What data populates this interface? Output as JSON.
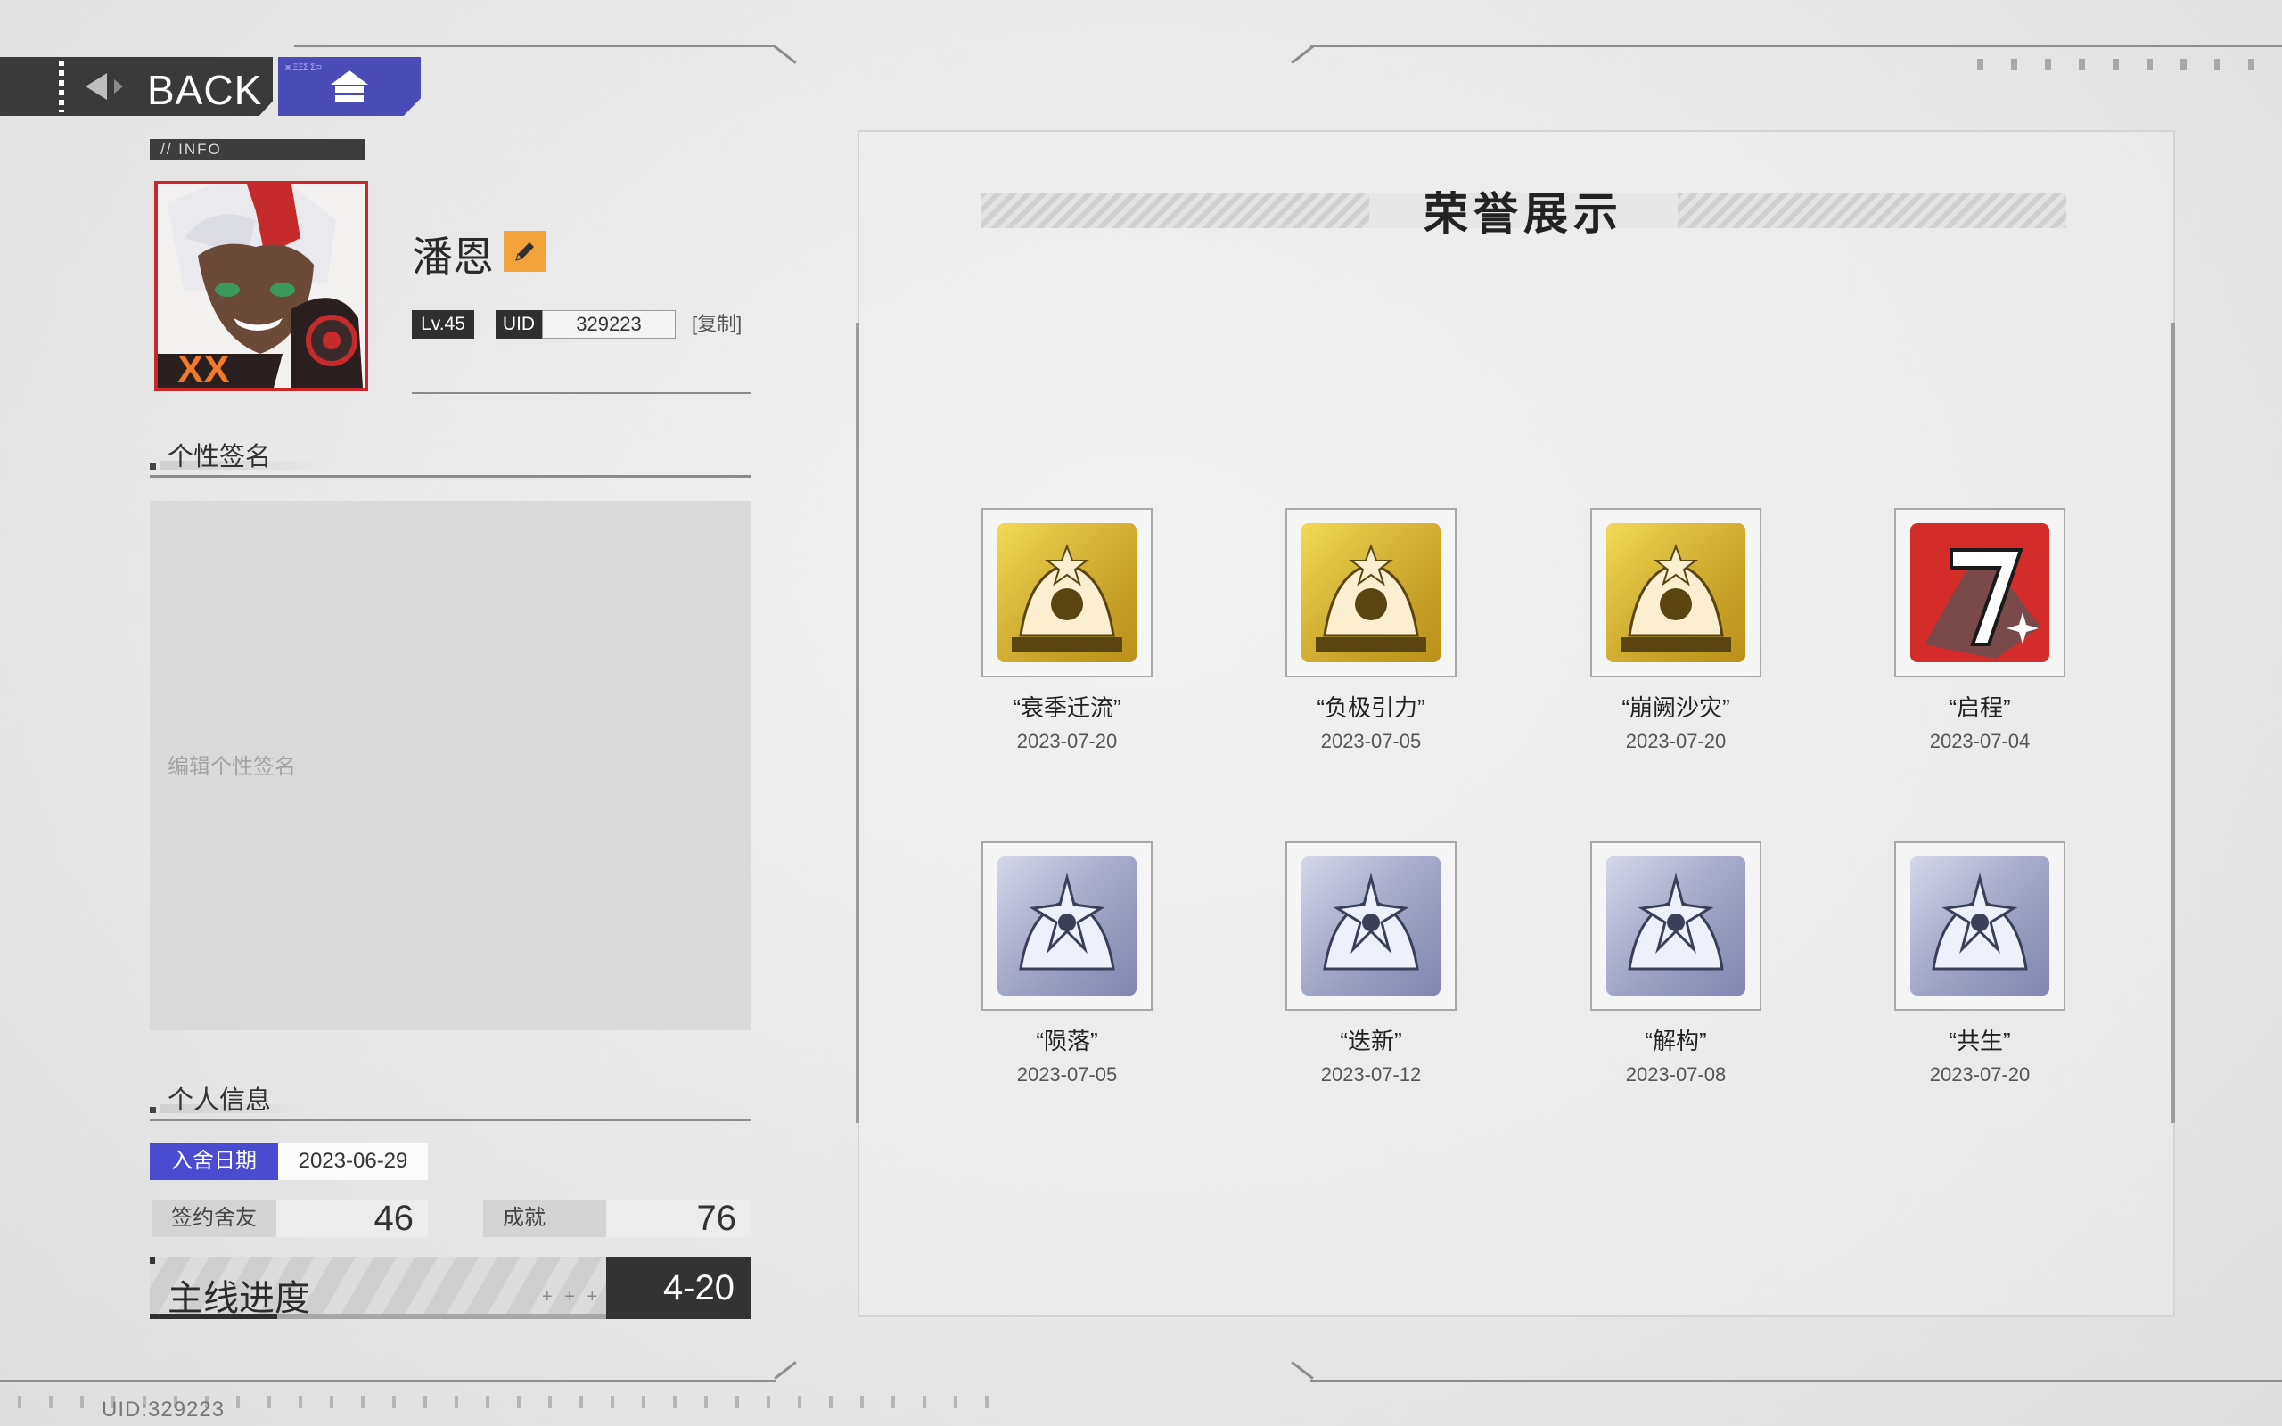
{
  "nav": {
    "back_label": "BACK",
    "home_small_text": "ж ΞΞΣ Σ⊃"
  },
  "info": {
    "tag": "// INFO",
    "name": "潘恩",
    "level": "Lv.45",
    "uid_label": "UID",
    "uid_value": "329223",
    "copy_label": "[复制]"
  },
  "signature": {
    "section_title": "个性签名",
    "placeholder": "编辑个性签名"
  },
  "personal": {
    "section_title": "个人信息",
    "join_label": "入舍日期",
    "join_date": "2023-06-29",
    "friends_label": "签约舍友",
    "friends_value": "46",
    "achievements_label": "成就",
    "achievements_value": "76",
    "progress_label": "主线进度",
    "progress_plus": "+ + +",
    "progress_value": "4-20",
    "progress_fraction": 0.28
  },
  "footer": {
    "uid_text": "UID:329223"
  },
  "honor": {
    "title": "荣誉展示",
    "medals": [
      {
        "name": "“衰季迁流”",
        "date": "2023-07-20",
        "tier": "gold",
        "icon": "gold-mech-medal-icon"
      },
      {
        "name": "“负极引力”",
        "date": "2023-07-05",
        "tier": "gold",
        "icon": "gold-figure-medal-icon"
      },
      {
        "name": "“崩阙沙灾”",
        "date": "2023-07-20",
        "tier": "gold",
        "icon": "gold-crown-medal-icon"
      },
      {
        "name": "“启程”",
        "date": "2023-07-04",
        "tier": "red",
        "icon": "red-seven-medal-icon"
      },
      {
        "name": "“陨落”",
        "date": "2023-07-05",
        "tier": "silver",
        "icon": "silver-star-medal-icon"
      },
      {
        "name": "“迭新”",
        "date": "2023-07-12",
        "tier": "silver",
        "icon": "silver-cross-medal-icon"
      },
      {
        "name": "“解构”",
        "date": "2023-07-08",
        "tier": "silver",
        "icon": "silver-clapper-medal-icon"
      },
      {
        "name": "“共生”",
        "date": "2023-07-20",
        "tier": "silver",
        "icon": "silver-helmet-medal-icon"
      }
    ]
  },
  "colors": {
    "accent_blue": "#4b4bd2",
    "home_blue": "#4b4bb8",
    "edit_orange": "#f1a33a",
    "avatar_red": "#c9282b",
    "gold": "#d8ad2a",
    "silver": "#9aa0c8",
    "red_medal": "#d42b2b"
  }
}
